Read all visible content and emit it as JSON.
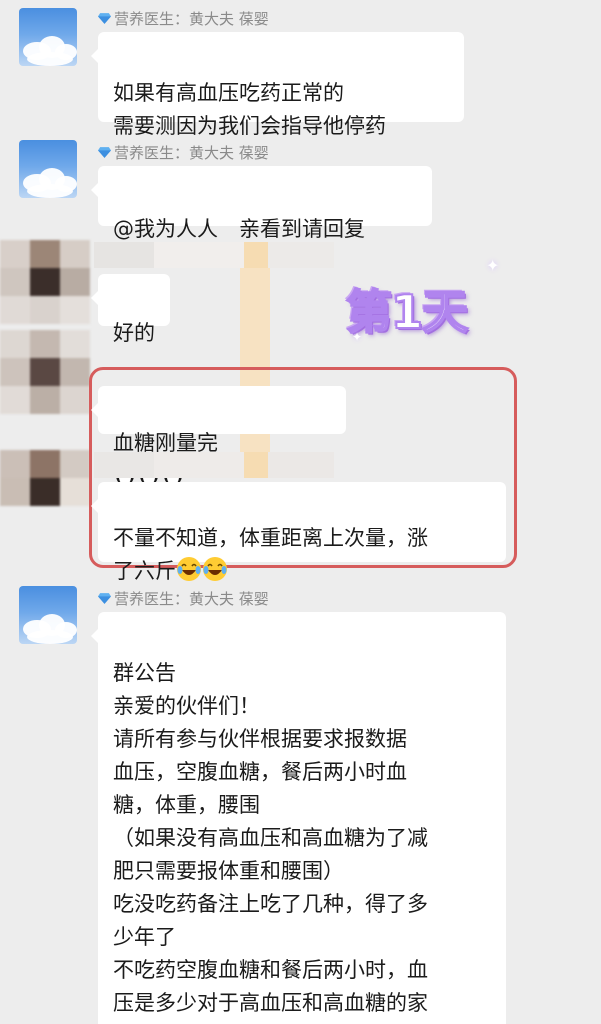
{
  "messages": [
    {
      "sender": "营养医生：黄大夫 葆婴",
      "text": "如果有高血压吃药正常的\n需要测因为我们会指导他停药"
    },
    {
      "sender": "营养医生：黄大夫 葆婴",
      "text": "@我为人人　亲看到请回复"
    },
    {
      "text": "好的"
    },
    {
      "text": "血糖刚量完"
    },
    {
      "text": "不量不知道，体重距离上次量，涨\n了六斤"
    },
    {
      "sender": "营养医生：黄大夫 葆婴",
      "text": "群公告\n亲爱的伙伴们！\n请所有参与伙伴根据要求报数据\n血压，空腹血糖，餐后两小时血\n糖，体重，腰围\n（如果没有高血压和高血糖为了减\n肥只需要报体重和腰围）\n吃没吃药备注上吃了几种，得了多\n少年了\n不吃药空腹血糖和餐后两小时，血\n压是多少对于高血压和高血糖的家\n人需要报"
    }
  ],
  "badge": {
    "text": "第1天"
  },
  "icons": {
    "doctor_avatar": "sky-avatar-icon",
    "diamond": "diamond-icon",
    "penguin": "penguin-emoji-icon",
    "laugh_cry": "laugh-cry-emoji-icon"
  },
  "colors": {
    "highlight_border": "#d65c5c",
    "badge_purple": "#b084ee",
    "background": "#ededed"
  }
}
